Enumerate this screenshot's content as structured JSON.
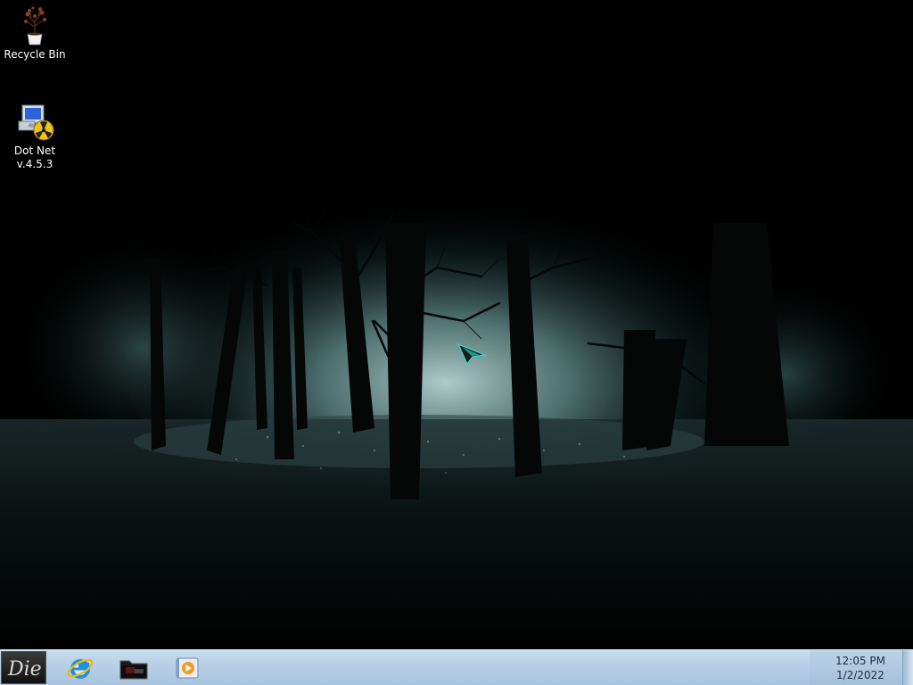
{
  "desktop": {
    "icons": [
      {
        "label": "Recycle Bin",
        "icon": "recycle-bin-plant-icon"
      },
      {
        "label": "Dot Net\nv.4.5.3",
        "label_line1": "Dot Net",
        "label_line2": "v.4.5.3",
        "icon": "dotnet-installer-icon"
      }
    ],
    "wallpaper": "dark-misty-forest"
  },
  "taskbar": {
    "start_button_text": "Die",
    "pinned": [
      {
        "name": "Internet Explorer",
        "icon": "internet-explorer-icon"
      },
      {
        "name": "File Explorer",
        "icon": "folder-icon"
      },
      {
        "name": "Media Player",
        "icon": "media-player-icon"
      }
    ],
    "clock": {
      "time": "12:05 PM",
      "date": "1/2/2022"
    }
  },
  "colors": {
    "taskbar_top": "#c9dcee",
    "taskbar_bottom": "#a9c4df",
    "clock_text": "#1e2d3d",
    "fog": "#9fc5c2"
  }
}
